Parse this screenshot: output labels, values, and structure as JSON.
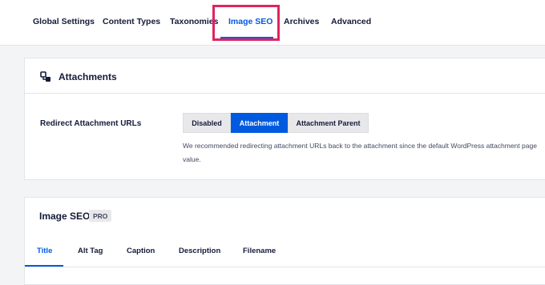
{
  "nav": {
    "tabs": [
      "Global Settings",
      "Content Types",
      "Taxonomies",
      "Image SEO",
      "Archives",
      "Advanced"
    ],
    "active": "Image SEO"
  },
  "attachments": {
    "title": "Attachments",
    "redirect_label": "Redirect Attachment URLs",
    "options": [
      "Disabled",
      "Attachment",
      "Attachment Parent"
    ],
    "selected": "Attachment",
    "description_line1": "We recommended redirecting attachment URLs back to the attachment since the default WordPress attachment page",
    "description_line2": "value."
  },
  "image_seo": {
    "title": "Image SEO",
    "badge": "PRO",
    "tabs": [
      "Title",
      "Alt Tag",
      "Caption",
      "Description",
      "Filename"
    ],
    "active_tab": "Title"
  },
  "colors": {
    "accent": "#005ae0",
    "highlight": "#e0245e"
  }
}
